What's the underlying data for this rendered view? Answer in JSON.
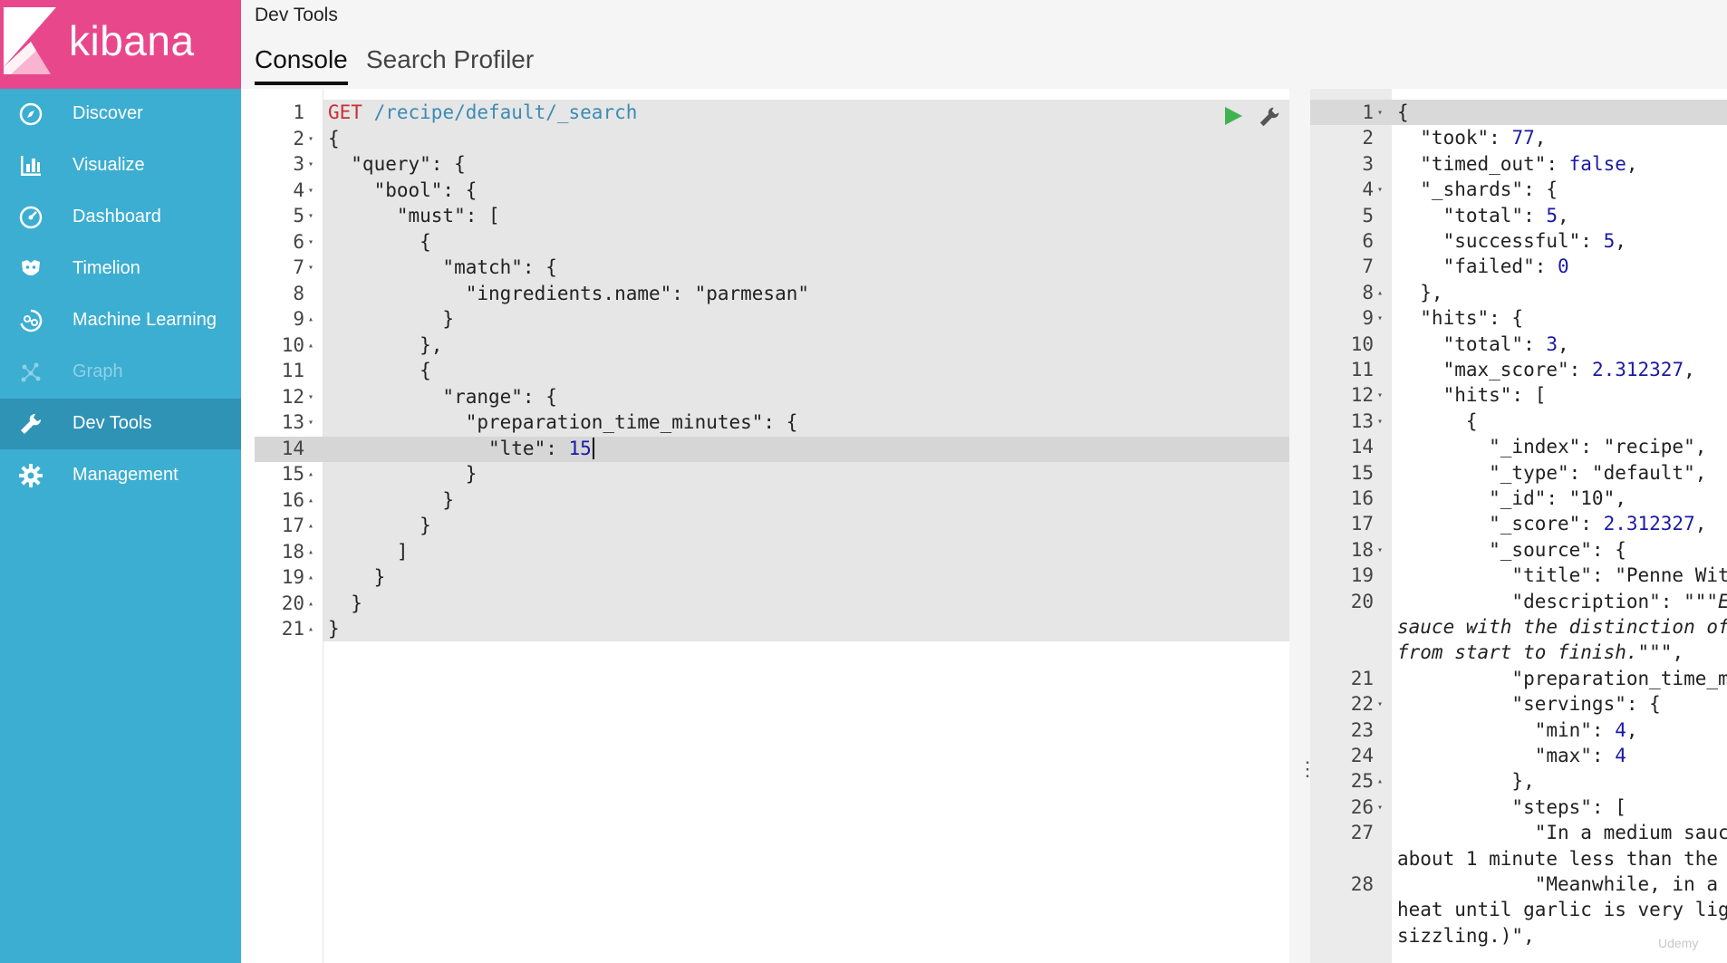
{
  "app": {
    "name": "kibana",
    "brand_color": "#e8488b",
    "sidebar_color": "#3caed2"
  },
  "sidebar": {
    "items": [
      {
        "label": "Discover",
        "icon": "compass-icon"
      },
      {
        "label": "Visualize",
        "icon": "bar-chart-icon"
      },
      {
        "label": "Dashboard",
        "icon": "dashboard-icon"
      },
      {
        "label": "Timelion",
        "icon": "timelion-icon"
      },
      {
        "label": "Machine Learning",
        "icon": "machine-learning-icon"
      },
      {
        "label": "Graph",
        "icon": "graph-icon",
        "state": "disabled"
      },
      {
        "label": "Dev Tools",
        "icon": "wrench-icon",
        "state": "active"
      },
      {
        "label": "Management",
        "icon": "gear-icon"
      }
    ]
  },
  "header": {
    "title": "Dev Tools",
    "tabs": [
      {
        "label": "Console",
        "state": "active"
      },
      {
        "label": "Search Profiler"
      }
    ]
  },
  "request": {
    "method": "GET",
    "path": "/recipe/default/_search",
    "line_numbers": [
      "1",
      "2",
      "3",
      "4",
      "5",
      "6",
      "7",
      "8",
      "9",
      "10",
      "11",
      "12",
      "13",
      "14",
      "15",
      "16",
      "17",
      "18",
      "19",
      "20",
      "21"
    ],
    "lines": [
      "{",
      "  \"query\": {",
      "    \"bool\": {",
      "      \"must\": [",
      "        {",
      "          \"match\": {",
      "            \"ingredients.name\": \"parmesan\"",
      "          }",
      "        },",
      "        {",
      "          \"range\": {",
      "            \"preparation_time_minutes\": {",
      "              \"lte\": ",
      "            }",
      "          }",
      "        }",
      "      ]",
      "    }",
      "  }",
      "}"
    ],
    "lte_value": "15",
    "run_icon": "play-icon",
    "settings_icon": "wrench-icon"
  },
  "response": {
    "rows": [
      {
        "n": "1",
        "t": "{"
      },
      {
        "n": "2",
        "t": "  \"took\": ",
        "v": "77",
        "e": ","
      },
      {
        "n": "3",
        "t": "  \"timed_out\": ",
        "v": "false",
        "e": ","
      },
      {
        "n": "4",
        "t": "  \"_shards\": {"
      },
      {
        "n": "5",
        "t": "    \"total\": ",
        "v": "5",
        "e": ","
      },
      {
        "n": "6",
        "t": "    \"successful\": ",
        "v": "5",
        "e": ","
      },
      {
        "n": "7",
        "t": "    \"failed\": ",
        "v": "0"
      },
      {
        "n": "8",
        "t": "  },"
      },
      {
        "n": "9",
        "t": "  \"hits\": {"
      },
      {
        "n": "10",
        "t": "    \"total\": ",
        "v": "3",
        "e": ","
      },
      {
        "n": "11",
        "t": "    \"max_score\": ",
        "v": "2.312327",
        "e": ","
      },
      {
        "n": "12",
        "t": "    \"hits\": ["
      },
      {
        "n": "13",
        "t": "      {"
      },
      {
        "n": "14",
        "t": "        \"_index\": \"recipe\","
      },
      {
        "n": "15",
        "t": "        \"_type\": \"default\","
      },
      {
        "n": "16",
        "t": "        \"_id\": \"10\","
      },
      {
        "n": "17",
        "t": "        \"_score\": ",
        "v": "2.312327",
        "e": ","
      },
      {
        "n": "18",
        "t": "        \"_source\": {"
      },
      {
        "n": "19",
        "t": "          \"title\": \"Penne Wit"
      },
      {
        "n": "20",
        "t": "          \"description\": \"\"\"",
        "i": "E"
      },
      {
        "n": "",
        "t": "",
        "i": "sauce with the distinction of"
      },
      {
        "n": "",
        "t": "",
        "i": "from start to finish.\"\"\"",
        "e": ","
      },
      {
        "n": "21",
        "t": "          \"preparation_time_m"
      },
      {
        "n": "22",
        "t": "          \"servings\": {"
      },
      {
        "n": "23",
        "t": "            \"min\": ",
        "v": "4",
        "e": ","
      },
      {
        "n": "24",
        "t": "            \"max\": ",
        "v": "4"
      },
      {
        "n": "25",
        "t": "          },"
      },
      {
        "n": "26",
        "t": "          \"steps\": ["
      },
      {
        "n": "27",
        "t": "            \"In a medium sauc"
      },
      {
        "n": "",
        "t": "about 1 minute less than the"
      },
      {
        "n": "28",
        "t": "            \"Meanwhile, in a"
      },
      {
        "n": "",
        "t": "heat until garlic is very lig"
      },
      {
        "n": "",
        "t": "sizzling.)\","
      }
    ]
  },
  "watermark": "Udemy"
}
